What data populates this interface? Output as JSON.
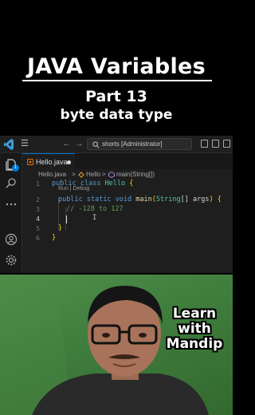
{
  "title": {
    "main": "JAVA Variables",
    "part": "Part 13",
    "topic": "byte data type"
  },
  "vscode": {
    "titlebar": {
      "search_text": "shorts [Administrator]",
      "back_arrow": "←",
      "forward_arrow": "→",
      "menu_glyph": "☰"
    },
    "activity_badge": "1",
    "tab": {
      "label": "Hello.java",
      "modified": true
    },
    "breadcrumb": {
      "file": "Hello.java",
      "class": "Hello",
      "method": "main(String[])",
      "separator": ">"
    },
    "codelens": "Run | Debug",
    "line_numbers": [
      "1",
      "2",
      "3",
      "4",
      "5",
      "6"
    ],
    "active_line": "4",
    "code": {
      "l1_kw1": "public",
      "l1_kw2": "class",
      "l1_name": "Hello",
      "l1_brace": "{",
      "l2_kw1": "public",
      "l2_kw2": "static",
      "l2_kw3": "void",
      "l2_fn": "main",
      "l2_open": "(",
      "l2_type": "String",
      "l2_params": "[] args",
      "l2_close": ")",
      "l2_brace": "{",
      "l3_comment": "// -128 to 127",
      "l5_brace": "}",
      "l6_brace": "}"
    }
  },
  "webcam": {
    "overlay_line1": "Learn",
    "overlay_line2": "with",
    "overlay_line3": "Mandip"
  },
  "colors": {
    "editor_bg": "#1e1e1e",
    "keyword": "#569cd6",
    "type": "#4ec9b0",
    "function": "#dcdcaa",
    "comment": "#6a9955",
    "accent": "#0078d4",
    "wall_green": "#3f7d3d"
  },
  "icons": [
    "vscode-logo-icon",
    "menu-icon",
    "search-icon",
    "explorer-icon",
    "search-sidebar-icon",
    "more-icon",
    "account-icon",
    "settings-icon",
    "java-file-icon",
    "layout-icon"
  ]
}
